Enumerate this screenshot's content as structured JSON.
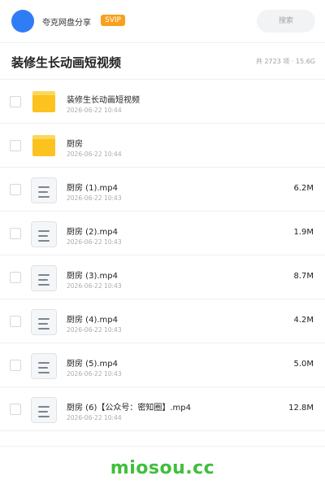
{
  "header": {
    "share_name": "夸克网盘分享",
    "badge": "SVIP",
    "search_placeholder": "搜索",
    "avatar_color": "#2f7cf6",
    "badge_color": "#f8a11f"
  },
  "folder": {
    "title": "装修生长动画短视频",
    "summary": "共 2723 项 · 15.6G"
  },
  "items": [
    {
      "type": "folder",
      "icon": "folder-icon",
      "name": "装修生长动画短视频",
      "date": "2026-06-22 10:44",
      "size": ""
    },
    {
      "type": "folder",
      "icon": "folder-icon",
      "name": "厨房",
      "date": "2026-06-22 10:44",
      "size": ""
    },
    {
      "type": "file",
      "icon": "file-icon",
      "name": "厨房 (1).mp4",
      "date": "2026-06-22 10:43",
      "size": "6.2M"
    },
    {
      "type": "file",
      "icon": "file-icon",
      "name": "厨房 (2).mp4",
      "date": "2026-06-22 10:43",
      "size": "1.9M"
    },
    {
      "type": "file",
      "icon": "file-icon",
      "name": "厨房 (3).mp4",
      "date": "2026-06-22 10:43",
      "size": "8.7M"
    },
    {
      "type": "file",
      "icon": "file-icon",
      "name": "厨房 (4).mp4",
      "date": "2026-06-22 10:43",
      "size": "4.2M"
    },
    {
      "type": "file",
      "icon": "file-icon",
      "name": "厨房 (5).mp4",
      "date": "2026-06-22 10:43",
      "size": "5.0M"
    },
    {
      "type": "file",
      "icon": "file-icon",
      "name": "厨房 (6)【公众号：密知圈】.mp4",
      "date": "2026-06-22 10:44",
      "size": "12.8M"
    }
  ],
  "watermark": {
    "text": "miosou.cc",
    "color": "#3fbf3a"
  }
}
